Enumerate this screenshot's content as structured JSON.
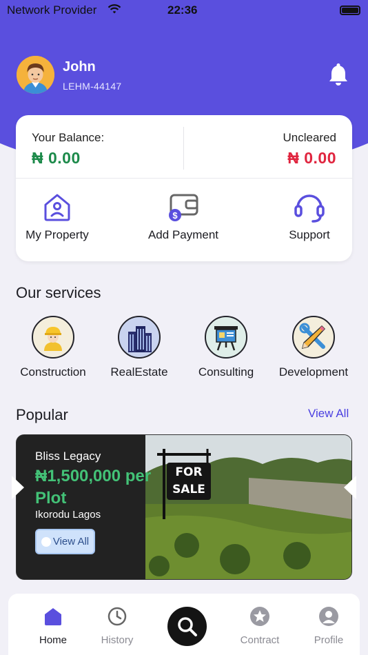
{
  "status_bar": {
    "carrier": "Network Provider",
    "time": "22:36"
  },
  "user": {
    "name": "John",
    "id": "LEHM-44147"
  },
  "balance": {
    "label": "Your Balance:",
    "value": "₦ 0.00",
    "value_color": "#1c8a4a",
    "uncleared_label": "Uncleared",
    "uncleared_value": "₦ 0.00",
    "uncleared_color": "#e0253f"
  },
  "actions": [
    {
      "label": "My Property",
      "icon": "house-icon"
    },
    {
      "label": "Add Payment",
      "icon": "wallet-icon"
    },
    {
      "label": "Support",
      "icon": "headset-icon"
    }
  ],
  "services_title": "Our services",
  "services": [
    {
      "label": "Construction",
      "icon": "construction-worker-icon"
    },
    {
      "label": "RealEstate",
      "icon": "building-icon"
    },
    {
      "label": "Consulting",
      "icon": "presentation-board-icon"
    },
    {
      "label": "Development",
      "icon": "tools-icon"
    }
  ],
  "popular": {
    "title": "Popular",
    "view_all": "View All",
    "card": {
      "name": "Bliss Legacy",
      "price": "₦1,500,000 per Plot",
      "location": "Ikorodu Lagos",
      "button": "View All",
      "sign_line1": "FOR",
      "sign_line2": "SALE"
    }
  },
  "tabs": [
    {
      "label": "Home",
      "icon": "home-icon",
      "active": true
    },
    {
      "label": "History",
      "icon": "clock-icon"
    },
    {
      "label": "",
      "icon": "search-icon"
    },
    {
      "label": "Contract",
      "icon": "star-icon"
    },
    {
      "label": "Profile",
      "icon": "person-icon"
    }
  ],
  "colors": {
    "primary": "#5a4fde",
    "accent_link": "#4a3fe0",
    "price_green": "#43c277"
  }
}
